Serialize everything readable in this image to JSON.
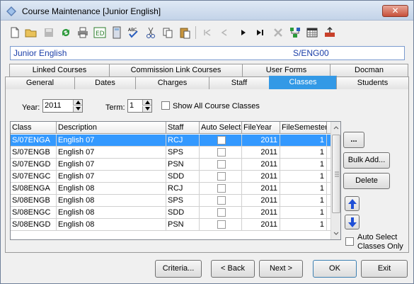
{
  "window": {
    "title": "Course Maintenance  [Junior English]",
    "close_glyph": "✕"
  },
  "header": {
    "course_name": "Junior English",
    "course_code": "S/ENG00"
  },
  "tabs_row1": [
    "Linked Courses",
    "Commission Link Courses",
    "User Forms",
    "Docman"
  ],
  "tabs_row2": [
    "General",
    "Dates",
    "Charges",
    "Staff",
    "Classes",
    "Students"
  ],
  "active_tab": "Classes",
  "filters": {
    "year_label": "Year:",
    "year_value": "2011",
    "term_label": "Term:",
    "term_value": "1",
    "show_all_label": "Show All Course Classes"
  },
  "grid": {
    "columns": [
      "Class",
      "Description",
      "Staff",
      "Auto Select",
      "FileYear",
      "FileSemester"
    ],
    "rows": [
      [
        "S/07ENGA",
        "English 07",
        "RCJ",
        "",
        "2011",
        "1"
      ],
      [
        "S/07ENGB",
        "English 07",
        "SPS",
        "",
        "2011",
        "1"
      ],
      [
        "S/07ENGD",
        "English 07",
        "PSN",
        "",
        "2011",
        "1"
      ],
      [
        "S/07ENGC",
        "English 07",
        "SDD",
        "",
        "2011",
        "1"
      ],
      [
        "S/08ENGA",
        "English 08",
        "RCJ",
        "",
        "2011",
        "1"
      ],
      [
        "S/08ENGB",
        "English 08",
        "SPS",
        "",
        "2011",
        "1"
      ],
      [
        "S/08ENGC",
        "English 08",
        "SDD",
        "",
        "2011",
        "1"
      ],
      [
        "S/08ENGD",
        "English 08",
        "PSN",
        "",
        "2011",
        "1"
      ]
    ]
  },
  "side_buttons": {
    "ellipsis": "...",
    "bulk_add": "Bulk Add...",
    "delete": "Delete"
  },
  "auto_select_only_label_1": "Auto Select",
  "auto_select_only_label_2": "Classes Only",
  "footer": {
    "criteria": "Criteria...",
    "back": "< Back",
    "next": "Next >",
    "ok": "OK",
    "exit": "Exit"
  },
  "colors": {
    "accent": "#3399ff",
    "header_text": "#1a3ea8",
    "active_tab": "#3399e6"
  }
}
